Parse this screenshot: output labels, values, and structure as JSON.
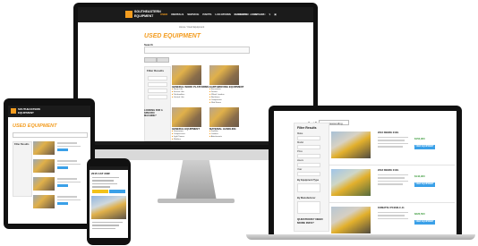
{
  "desktop": {
    "logo_line1": "SOUTHEASTERN",
    "logo_line2": "EQUIPMENT",
    "nav": [
      "USED",
      "RENTALS",
      "SERVICE",
      "PARTS",
      "LOCATIONS",
      "CAREERS",
      "CONTACT"
    ],
    "utility": [
      "CUSTOMER LOGIN",
      "EN",
      "$",
      "▣"
    ],
    "breadcrumb": "Home / Used Equipment",
    "page_title": "USED EQUIPMENT",
    "search_label": "Search",
    "filter_title": "Filter Results",
    "cta_heading": "LOOKING FOR A SPECIFIC MACHINE?",
    "categories": [
      {
        "title": "GENERAL WORK PLATFORMS",
        "items": [
          "Boom Lifts",
          "Scissor Lifts",
          "Telehandlers",
          "Vertical Lifts"
        ]
      },
      {
        "title": "EARTHMOVING EQUIPMENT",
        "items": [
          "Excavators",
          "Dozers",
          "Wheel Loaders",
          "Backhoes",
          "Compactors",
          "Skid Steers"
        ]
      },
      {
        "title": "GENERAL EQUIPMENT",
        "items": [
          "Generators",
          "Compressors",
          "Light Towers",
          "Welders",
          "Pumps"
        ]
      },
      {
        "title": "MATERIAL HANDLING",
        "items": [
          "Forklifts",
          "Loaders",
          "Attachments",
          "Trailers"
        ]
      }
    ]
  },
  "tablet": {
    "page_title": "USED EQUIPMENT",
    "filter_title": "Filter Results"
  },
  "phone": {
    "title": "2015 CAT 330F"
  },
  "laptop": {
    "sort_label": "Sort By:",
    "sort_value": "Price Descending",
    "filter_title": "Filter Results",
    "filter_labels": [
      "Make",
      "Model",
      "Price",
      "Hours",
      "Year",
      "By Equipment Type",
      "By Manufacturer"
    ],
    "cta_heading": "QUESTIONS? NEED MORE INFO?",
    "listings": [
      {
        "name": "2016 DEERE 210G",
        "price": "$152,900",
        "button": "VIEW EQUIPMENT"
      },
      {
        "name": "2018 DEERE 210G",
        "price": "$142,900",
        "button": "VIEW EQUIPMENT"
      },
      {
        "name": "KOMATSU PC290LC-11",
        "price": "$226,500",
        "button": "VIEW EQUIPMENT"
      }
    ]
  },
  "colors": {
    "brand_orange": "#f39c1f",
    "header_dark": "#1b1b1b",
    "button_blue": "#3aa0e8",
    "price_green": "#3a9a3a"
  }
}
